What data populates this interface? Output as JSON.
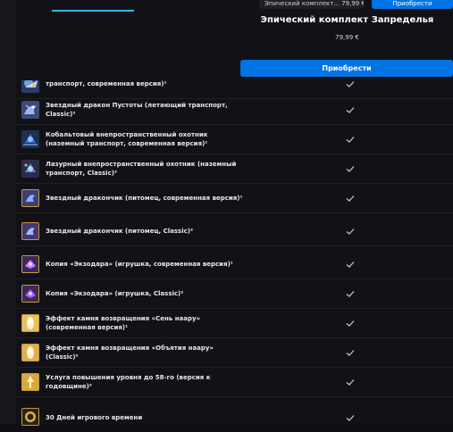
{
  "header": {
    "top_item_label": "Эпический комплект... 79,99 €",
    "top_buy_label": "Приобрести",
    "bundle_title": "Эпический комплект Запределья",
    "bundle_price": "79,99 €",
    "buy_label": "Приобрести"
  },
  "colors": {
    "accent": "#0074e4",
    "tab_accent": "#26bbff",
    "background": "#121216"
  },
  "items": [
    {
      "name": "транспорт, современная версия)¹",
      "icon": "ship-icon",
      "included": true
    },
    {
      "name": "Звездный дракон Пустоты (летающий транспорт, Classic)²",
      "icon": "dragon-icon",
      "included": true
    },
    {
      "name": "Кобальтовый внепространственный охотник (наземный транспорт, современная версия)¹",
      "icon": "hunter-icon",
      "included": true
    },
    {
      "name": "Лазурный внепространственный охотник (наземный транспорт, Classic)²",
      "icon": "hunter-icon",
      "included": true
    },
    {
      "name": "Звездный дракончик (питомец, современная версия)¹",
      "icon": "pet-dragon-icon",
      "included": true
    },
    {
      "name": "Звездный дракончик (питомец, Classic)²",
      "icon": "pet-dragon-icon",
      "included": true
    },
    {
      "name": "Копия «Экзодара» (игрушка, современная версия)¹",
      "icon": "exodar-toy-icon",
      "included": true
    },
    {
      "name": "Копия «Экзодара» (игрушка, Classic)²",
      "icon": "exodar-toy-icon",
      "included": true
    },
    {
      "name": "Эффект камня возвращения «Сень наару» (современная версия)¹",
      "icon": "hearthstone-effect-icon",
      "included": true
    },
    {
      "name": "Эффект камня возвращения «Объятия наару» (Classic)²",
      "icon": "hearthstone-effect-icon",
      "included": true
    },
    {
      "name": "Услуга повышения уровня до 58-го (версия к годовщине)²",
      "icon": "level-boost-icon",
      "included": true
    },
    {
      "name": "30 Дней игрового времени",
      "icon": "game-time-icon",
      "included": true
    }
  ]
}
